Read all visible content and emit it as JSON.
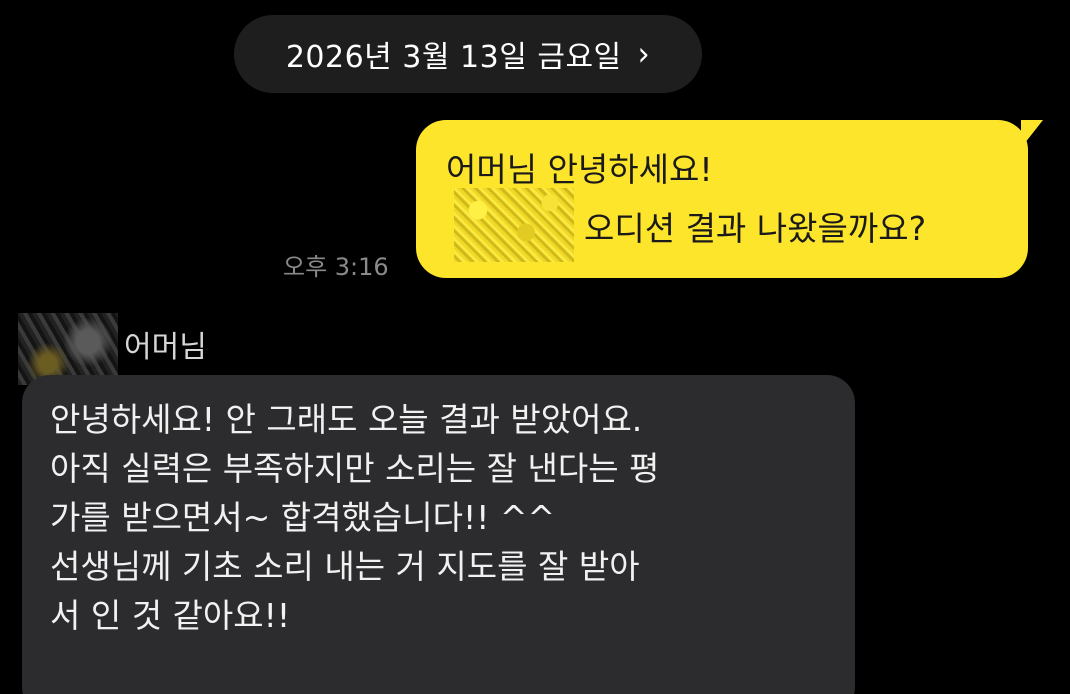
{
  "date_divider": {
    "label": "2026년 3월 13일 금요일",
    "chevron": "›"
  },
  "outgoing_message": {
    "line1": "어머님 안녕하세요!",
    "line2": "오디션 결과 나왔을까요?",
    "time": "오후 3:16",
    "bubble_color": "#fde52b"
  },
  "incoming_message": {
    "sender": "어머님",
    "lines": [
      "안녕하세요! 안 그래도 오늘 결과 받았어요.",
      "아직 실력은 부족하지만 소리는 잘 낸다는 평",
      "가를 받으면서~ 합격했습니다!! ^^",
      "선생님께 기초 소리 내는 거 지도를 잘 받아",
      "서 인 것 같아요!!"
    ],
    "bubble_color": "#2c2c2e"
  }
}
